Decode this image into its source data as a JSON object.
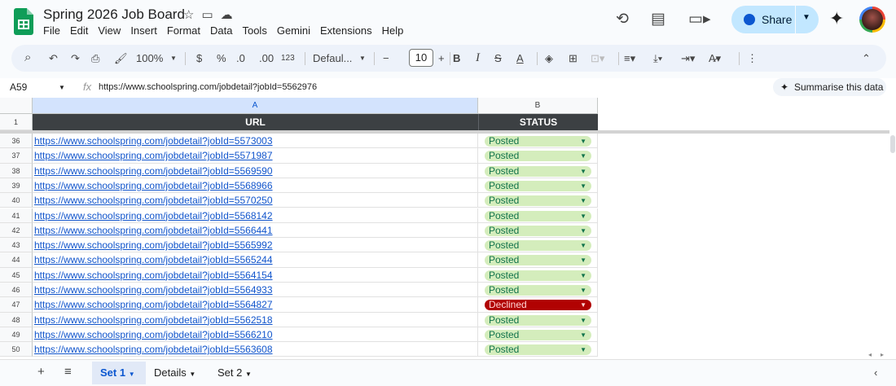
{
  "app": {
    "title": "Spring 2026 Job Board"
  },
  "menu": [
    "File",
    "Edit",
    "View",
    "Insert",
    "Format",
    "Data",
    "Tools",
    "Gemini",
    "Extensions",
    "Help"
  ],
  "share_label": "Share",
  "toolbar": {
    "zoom": "100%",
    "currency": "$",
    "percent": "%",
    "dec_dec": ".0",
    "inc_dec": ".00",
    "format_num": "123",
    "font": "Defaul...",
    "font_size": "10"
  },
  "formula_bar": {
    "cell_ref": "A59",
    "fx": "fx",
    "value": "https://www.schoolspring.com/jobdetail?jobId=5562976",
    "summarise": "Summarise this data"
  },
  "columns": [
    "A",
    "B"
  ],
  "header_row": {
    "number": "1",
    "url": "URL",
    "status": "STATUS"
  },
  "rows": [
    {
      "n": "36",
      "url": "https://www.schoolspring.com/jobdetail?jobId=5573003",
      "status": "Posted"
    },
    {
      "n": "37",
      "url": "https://www.schoolspring.com/jobdetail?jobId=5571987",
      "status": "Posted"
    },
    {
      "n": "38",
      "url": "https://www.schoolspring.com/jobdetail?jobId=5569590",
      "status": "Posted"
    },
    {
      "n": "39",
      "url": "https://www.schoolspring.com/jobdetail?jobId=5568966",
      "status": "Posted"
    },
    {
      "n": "40",
      "url": "https://www.schoolspring.com/jobdetail?jobId=5570250",
      "status": "Posted"
    },
    {
      "n": "41",
      "url": "https://www.schoolspring.com/jobdetail?jobId=5568142",
      "status": "Posted"
    },
    {
      "n": "42",
      "url": "https://www.schoolspring.com/jobdetail?jobId=5566441",
      "status": "Posted"
    },
    {
      "n": "43",
      "url": "https://www.schoolspring.com/jobdetail?jobId=5565992",
      "status": "Posted"
    },
    {
      "n": "44",
      "url": "https://www.schoolspring.com/jobdetail?jobId=5565244",
      "status": "Posted"
    },
    {
      "n": "45",
      "url": "https://www.schoolspring.com/jobdetail?jobId=5564154",
      "status": "Posted"
    },
    {
      "n": "46",
      "url": "https://www.schoolspring.com/jobdetail?jobId=5564933",
      "status": "Posted"
    },
    {
      "n": "47",
      "url": "https://www.schoolspring.com/jobdetail?jobId=5564827",
      "status": "Declined"
    },
    {
      "n": "48",
      "url": "https://www.schoolspring.com/jobdetail?jobId=5562518",
      "status": "Posted"
    },
    {
      "n": "49",
      "url": "https://www.schoolspring.com/jobdetail?jobId=5566210",
      "status": "Posted"
    },
    {
      "n": "50",
      "url": "https://www.schoolspring.com/jobdetail?jobId=5563608",
      "status": "Posted"
    }
  ],
  "status_colors": {
    "Posted": {
      "bg": "#d4edbc",
      "fg": "#11734b"
    },
    "Declined": {
      "bg": "#b10202",
      "fg": "#ffd5d5"
    }
  },
  "sheet_tabs": [
    "Set 1",
    "Details",
    "Set 2"
  ],
  "active_tab": "Set 1"
}
